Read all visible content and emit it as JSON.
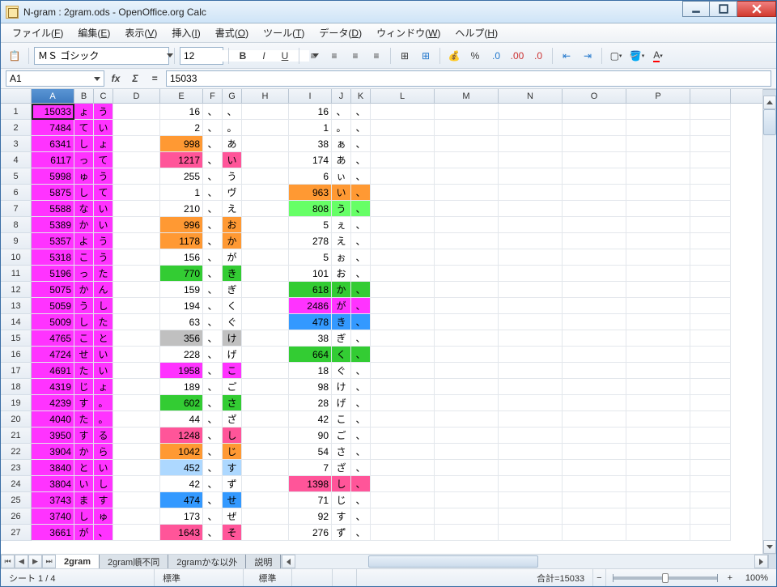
{
  "titlebar": {
    "title": "N-gram : 2gram.ods - OpenOffice.org Calc"
  },
  "menu": [
    "ファイル(F)",
    "編集(E)",
    "表示(V)",
    "挿入(I)",
    "書式(O)",
    "ツール(T)",
    "データ(D)",
    "ウィンドウ(W)",
    "ヘルプ(H)"
  ],
  "toolbar": {
    "font": "ＭＳ ゴシック",
    "size": "12"
  },
  "formula": {
    "ref": "A1",
    "value": "15033"
  },
  "columns": [
    "A",
    "B",
    "C",
    "D",
    "E",
    "F",
    "G",
    "H",
    "I",
    "J",
    "K",
    "L",
    "M",
    "N",
    "O",
    "P"
  ],
  "colwidths": [
    "cA",
    "cB",
    "cC",
    "cD",
    "cE",
    "cF",
    "cG",
    "cH",
    "cI",
    "cJ",
    "cK",
    "cL",
    "cM",
    "cN",
    "cO",
    "cP",
    "cQ"
  ],
  "rows": [
    {
      "n": 1,
      "cells": [
        "15033",
        "ょ",
        "う",
        "",
        "16",
        "、",
        "、",
        "",
        "16",
        "、",
        "、"
      ],
      "bg": [
        "magenta",
        "magenta",
        "magenta",
        "",
        "",
        "",
        "",
        "",
        "",
        "",
        ""
      ]
    },
    {
      "n": 2,
      "cells": [
        "7484",
        "て",
        "い",
        "",
        "2",
        "、",
        "。",
        "",
        "1",
        "。",
        "、"
      ],
      "bg": [
        "magenta",
        "magenta",
        "magenta",
        "",
        "",
        "",
        "",
        "",
        "",
        "",
        ""
      ]
    },
    {
      "n": 3,
      "cells": [
        "6341",
        "し",
        "ょ",
        "",
        "998",
        "、",
        "あ",
        "",
        "38",
        "ぁ",
        "、"
      ],
      "bg": [
        "magenta",
        "magenta",
        "magenta",
        "",
        "orange",
        "",
        "",
        "",
        "",
        "",
        ""
      ]
    },
    {
      "n": 4,
      "cells": [
        "6117",
        "っ",
        "て",
        "",
        "1217",
        "、",
        "い",
        "",
        "174",
        "あ",
        "、"
      ],
      "bg": [
        "magenta",
        "magenta",
        "magenta",
        "",
        "red",
        "",
        "red",
        "",
        "",
        "",
        ""
      ]
    },
    {
      "n": 5,
      "cells": [
        "5998",
        "ゅ",
        "う",
        "",
        "255",
        "、",
        "う",
        "",
        "6",
        "ぃ",
        "、"
      ],
      "bg": [
        "magenta",
        "magenta",
        "magenta",
        "",
        "",
        "",
        "",
        "",
        "",
        "",
        ""
      ]
    },
    {
      "n": 6,
      "cells": [
        "5875",
        "し",
        "て",
        "",
        "1",
        "、",
        "ヴ",
        "",
        "963",
        "い",
        "、"
      ],
      "bg": [
        "magenta",
        "magenta",
        "magenta",
        "",
        "",
        "",
        "",
        "",
        "orange",
        "orange",
        "orange"
      ]
    },
    {
      "n": 7,
      "cells": [
        "5588",
        "な",
        "い",
        "",
        "210",
        "、",
        "え",
        "",
        "808",
        "う",
        "、"
      ],
      "bg": [
        "magenta",
        "magenta",
        "magenta",
        "",
        "",
        "",
        "",
        "",
        "lgreen",
        "lgreen",
        "lgreen"
      ]
    },
    {
      "n": 8,
      "cells": [
        "5389",
        "か",
        "い",
        "",
        "996",
        "、",
        "お",
        "",
        "5",
        "ぇ",
        "、"
      ],
      "bg": [
        "magenta",
        "magenta",
        "magenta",
        "",
        "orange",
        "",
        "orange",
        "",
        "",
        "",
        ""
      ]
    },
    {
      "n": 9,
      "cells": [
        "5357",
        "よ",
        "う",
        "",
        "1178",
        "、",
        "か",
        "",
        "278",
        "え",
        "、"
      ],
      "bg": [
        "magenta",
        "magenta",
        "magenta",
        "",
        "orange",
        "",
        "orange",
        "",
        "",
        "",
        ""
      ]
    },
    {
      "n": 10,
      "cells": [
        "5318",
        "こ",
        "う",
        "",
        "156",
        "、",
        "が",
        "",
        "5",
        "ぉ",
        "、"
      ],
      "bg": [
        "magenta",
        "magenta",
        "magenta",
        "",
        "",
        "",
        "",
        "",
        "",
        "",
        ""
      ]
    },
    {
      "n": 11,
      "cells": [
        "5196",
        "っ",
        "た",
        "",
        "770",
        "、",
        "き",
        "",
        "101",
        "お",
        "、"
      ],
      "bg": [
        "magenta",
        "magenta",
        "magenta",
        "",
        "green",
        "",
        "green",
        "",
        "",
        "",
        ""
      ]
    },
    {
      "n": 12,
      "cells": [
        "5075",
        "か",
        "ん",
        "",
        "159",
        "、",
        "ぎ",
        "",
        "618",
        "か",
        "、"
      ],
      "bg": [
        "magenta",
        "magenta",
        "magenta",
        "",
        "",
        "",
        "",
        "",
        "green",
        "green",
        "green"
      ]
    },
    {
      "n": 13,
      "cells": [
        "5059",
        "う",
        "し",
        "",
        "194",
        "、",
        "く",
        "",
        "2486",
        "が",
        "、"
      ],
      "bg": [
        "magenta",
        "magenta",
        "magenta",
        "",
        "",
        "",
        "",
        "",
        "magenta",
        "magenta",
        "magenta"
      ]
    },
    {
      "n": 14,
      "cells": [
        "5009",
        "し",
        "た",
        "",
        "63",
        "、",
        "ぐ",
        "",
        "478",
        "き",
        "、"
      ],
      "bg": [
        "magenta",
        "magenta",
        "magenta",
        "",
        "",
        "",
        "",
        "",
        "blue",
        "blue",
        "blue"
      ]
    },
    {
      "n": 15,
      "cells": [
        "4765",
        "こ",
        "と",
        "",
        "356",
        "、",
        "け",
        "",
        "38",
        "ぎ",
        "、"
      ],
      "bg": [
        "magenta",
        "magenta",
        "magenta",
        "",
        "grey",
        "",
        "grey",
        "",
        "",
        "",
        ""
      ]
    },
    {
      "n": 16,
      "cells": [
        "4724",
        "せ",
        "い",
        "",
        "228",
        "、",
        "げ",
        "",
        "664",
        "く",
        "、"
      ],
      "bg": [
        "magenta",
        "magenta",
        "magenta",
        "",
        "",
        "",
        "",
        "",
        "green",
        "green",
        "green"
      ]
    },
    {
      "n": 17,
      "cells": [
        "4691",
        "た",
        "い",
        "",
        "1958",
        "、",
        "こ",
        "",
        "18",
        "ぐ",
        "、"
      ],
      "bg": [
        "magenta",
        "magenta",
        "magenta",
        "",
        "magenta",
        "",
        "magenta",
        "",
        "",
        "",
        ""
      ]
    },
    {
      "n": 18,
      "cells": [
        "4319",
        "じ",
        "ょ",
        "",
        "189",
        "、",
        "ご",
        "",
        "98",
        "け",
        "、"
      ],
      "bg": [
        "magenta",
        "magenta",
        "magenta",
        "",
        "",
        "",
        "",
        "",
        "",
        "",
        ""
      ]
    },
    {
      "n": 19,
      "cells": [
        "4239",
        "す",
        "。",
        "",
        "602",
        "、",
        "さ",
        "",
        "28",
        "げ",
        "、"
      ],
      "bg": [
        "magenta",
        "magenta",
        "magenta",
        "",
        "green",
        "",
        "green",
        "",
        "",
        "",
        ""
      ]
    },
    {
      "n": 20,
      "cells": [
        "4040",
        "た",
        "。",
        "",
        "44",
        "、",
        "ざ",
        "",
        "42",
        "こ",
        "、"
      ],
      "bg": [
        "magenta",
        "magenta",
        "magenta",
        "",
        "",
        "",
        "",
        "",
        "",
        "",
        ""
      ]
    },
    {
      "n": 21,
      "cells": [
        "3950",
        "す",
        "る",
        "",
        "1248",
        "、",
        "し",
        "",
        "90",
        "ご",
        "、"
      ],
      "bg": [
        "magenta",
        "magenta",
        "magenta",
        "",
        "red",
        "",
        "red",
        "",
        "",
        "",
        ""
      ]
    },
    {
      "n": 22,
      "cells": [
        "3904",
        "か",
        "ら",
        "",
        "1042",
        "、",
        "じ",
        "",
        "54",
        "さ",
        "、"
      ],
      "bg": [
        "magenta",
        "magenta",
        "magenta",
        "",
        "orange",
        "",
        "orange",
        "",
        "",
        "",
        ""
      ]
    },
    {
      "n": 23,
      "cells": [
        "3840",
        "と",
        "い",
        "",
        "452",
        "、",
        "す",
        "",
        "7",
        "ざ",
        "、"
      ],
      "bg": [
        "magenta",
        "magenta",
        "magenta",
        "",
        "lblue",
        "",
        "lblue",
        "",
        "",
        "",
        ""
      ]
    },
    {
      "n": 24,
      "cells": [
        "3804",
        "い",
        "し",
        "",
        "42",
        "、",
        "ず",
        "",
        "1398",
        "し",
        "、"
      ],
      "bg": [
        "magenta",
        "magenta",
        "magenta",
        "",
        "",
        "",
        "",
        "",
        "red",
        "red",
        "red"
      ]
    },
    {
      "n": 25,
      "cells": [
        "3743",
        "ま",
        "す",
        "",
        "474",
        "、",
        "せ",
        "",
        "71",
        "じ",
        "、"
      ],
      "bg": [
        "magenta",
        "magenta",
        "magenta",
        "",
        "blue",
        "",
        "blue",
        "",
        "",
        "",
        ""
      ]
    },
    {
      "n": 26,
      "cells": [
        "3740",
        "し",
        "ゅ",
        "",
        "173",
        "、",
        "ぜ",
        "",
        "92",
        "す",
        "、"
      ],
      "bg": [
        "magenta",
        "magenta",
        "magenta",
        "",
        "",
        "",
        "",
        "",
        "",
        "",
        ""
      ]
    },
    {
      "n": 27,
      "cells": [
        "3661",
        "が",
        "、",
        "",
        "1643",
        "、",
        "そ",
        "",
        "276",
        "ず",
        "、"
      ],
      "bg": [
        "magenta",
        "magenta",
        "magenta",
        "",
        "red",
        "",
        "red",
        "",
        "",
        "",
        ""
      ]
    }
  ],
  "sheettabs": [
    "2gram",
    "2gram順不同",
    "2gramかな以外",
    "説明"
  ],
  "status": {
    "sheet": "シート 1 / 4",
    "style": "標準",
    "mode": "標準",
    "sum": "合計=15033",
    "zoom": "100%"
  }
}
